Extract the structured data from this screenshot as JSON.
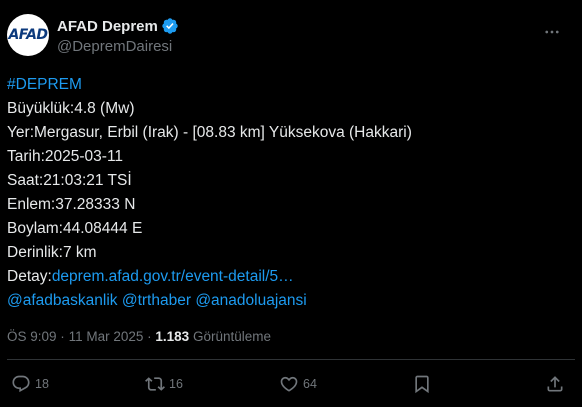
{
  "account": {
    "display_name": "AFAD Deprem",
    "handle": "@DepremDairesi",
    "avatar_text_blue": "AFAD",
    "verified": true
  },
  "tweet": {
    "lines": [
      {
        "text": "#DEPREM",
        "link": true
      },
      {
        "text": "Büyüklük:4.8 (Mw)"
      },
      {
        "text": "Yer:Mergasur, Erbil (Irak) - [08.83 km] Yüksekova (Hakkari)"
      },
      {
        "text": "Tarih:2025-03-11"
      },
      {
        "text": "Saat:21:03:21 TSİ"
      },
      {
        "text": "Enlem:37.28333 N"
      },
      {
        "text": "Boylam:44.08444 E"
      },
      {
        "text": "Derinlik:7 km"
      }
    ],
    "detail_label": "Detay:",
    "detail_link": "deprem.afad.gov.tr/event-detail/5…",
    "mentions": [
      "@afadbaskanlik",
      "@trthaber",
      "@anadoluajansi"
    ]
  },
  "meta": {
    "time": "ÖS 9:09",
    "date": "11 Mar 2025",
    "views_count": "1.183",
    "views_label": "Görüntüleme",
    "separator": "·"
  },
  "actions": {
    "replies": "18",
    "reposts": "16",
    "likes": "64"
  },
  "colors": {
    "background": "#000000",
    "text": "#e7e9ea",
    "secondary": "#71767b",
    "link": "#1d9bf0",
    "divider": "#2f3336"
  },
  "icons": {
    "verified": "verified-badge-icon",
    "more": "more-dots-icon",
    "reply": "reply-icon",
    "repost": "repost-icon",
    "like": "heart-icon",
    "bookmark": "bookmark-icon",
    "share": "share-icon"
  }
}
